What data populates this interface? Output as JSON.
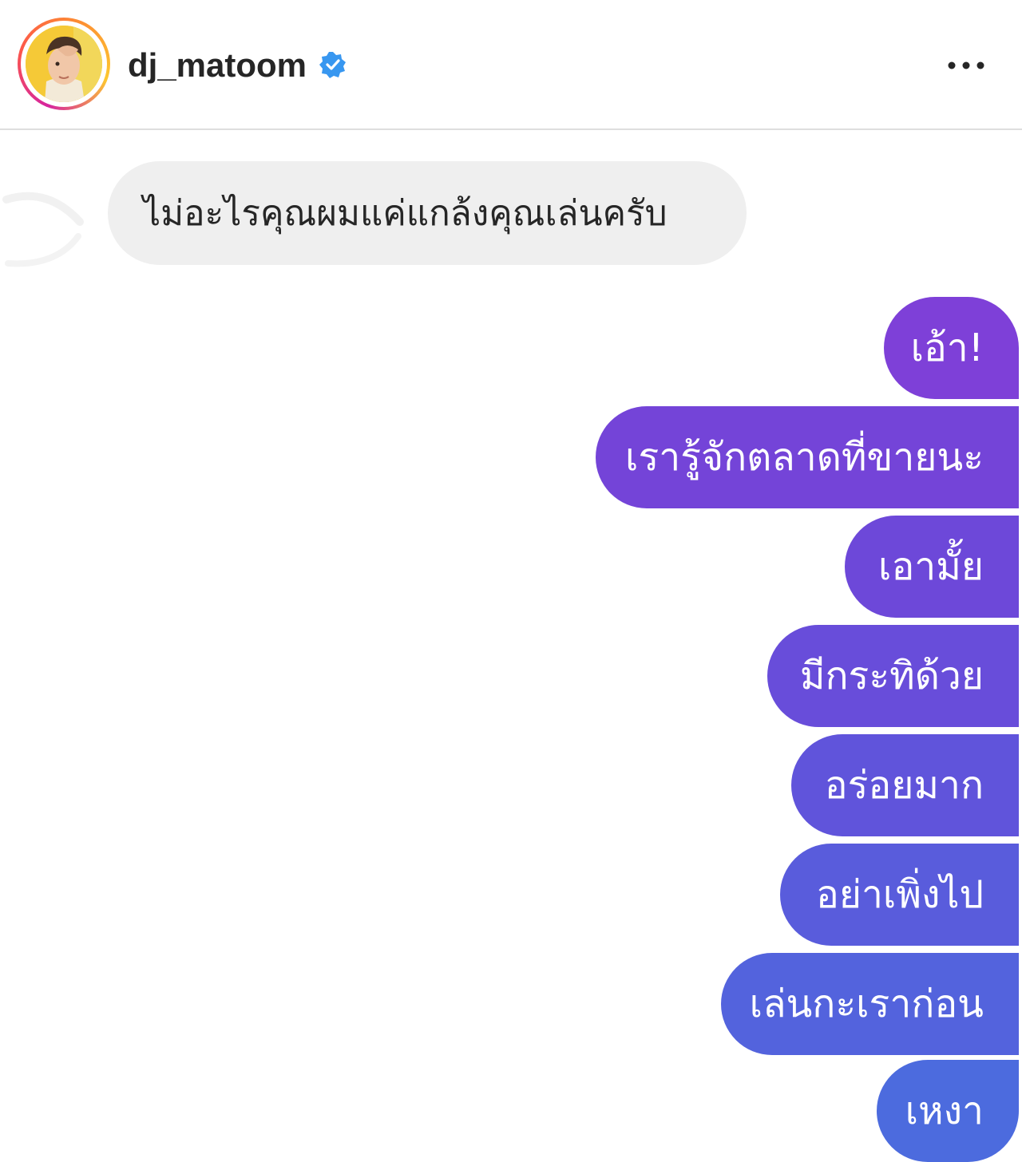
{
  "header": {
    "username": "dj_matoom",
    "verified": true,
    "more_icon": "more-horizontal-icon",
    "avatar": "profile-photo",
    "accent_colors": {
      "verified_badge": "#3897f0",
      "story_ring": [
        "#d6249f",
        "#fd5949",
        "#fdc830"
      ]
    }
  },
  "messages": [
    {
      "side": "incoming",
      "text": "ไม่อะไรคุณผมแค่แกล้งคุณเล่นครับ",
      "color": "#efefef"
    },
    {
      "side": "outgoing",
      "text": "เอ้า!",
      "color": "#7e40d8"
    },
    {
      "side": "outgoing",
      "text": "เรารู้จักตลาดที่ขายนะ",
      "color": "#7444d8"
    },
    {
      "side": "outgoing",
      "text": "เอามั้ย",
      "color": "#6d48d9"
    },
    {
      "side": "outgoing",
      "text": "มีกระทิด้วย",
      "color": "#684dda"
    },
    {
      "side": "outgoing",
      "text": "อร่อยมาก",
      "color": "#6054db"
    },
    {
      "side": "outgoing",
      "text": "อย่าเพิ่งไป",
      "color": "#595cdc"
    },
    {
      "side": "outgoing",
      "text": "เล่นกะเราก่อน",
      "color": "#5363dd"
    },
    {
      "side": "outgoing",
      "text": "เหงา",
      "color": "#4c6bde"
    }
  ]
}
